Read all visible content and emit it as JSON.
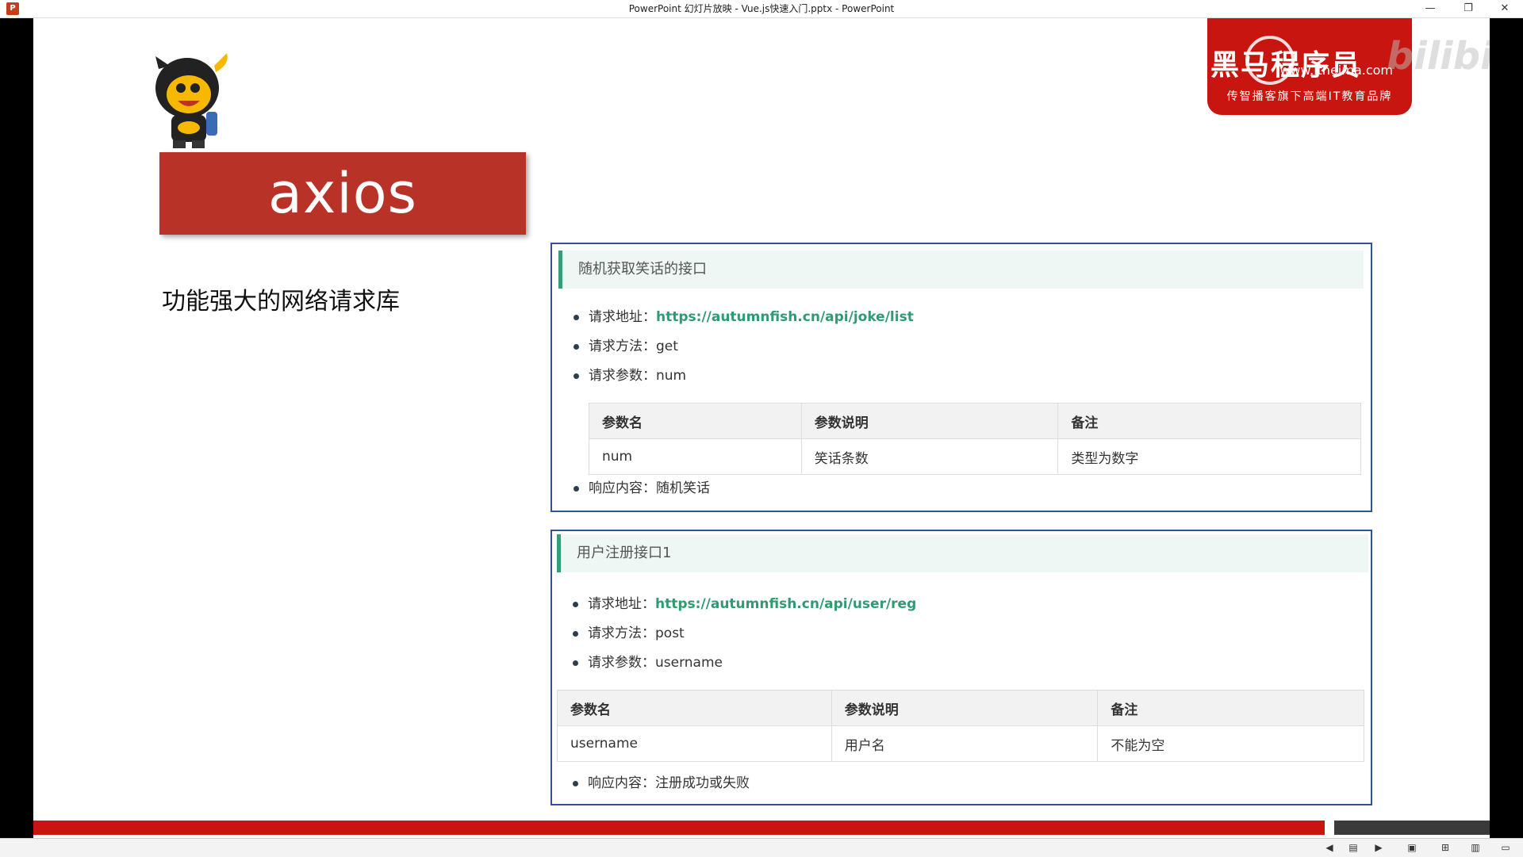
{
  "window": {
    "title": "PowerPoint 幻灯片放映  -  Vue.js快速入门.pptx - PowerPoint",
    "app_icon": "P",
    "minimize": "—",
    "restore": "❐",
    "close": "✕"
  },
  "slide": {
    "title": "axios",
    "subtitle": "功能强大的网络请求库",
    "logo": {
      "brand": "黑马程序员",
      "url": "www.itheima.com",
      "tagline": "传智播客旗下高端IT教育品牌"
    },
    "watermark": "bilibili",
    "cards": [
      {
        "header": "随机获取笑话的接口",
        "url_label": "请求地址：",
        "url": "https://autumnfish.cn/api/joke/list",
        "method_label": "请求方法：",
        "method": "get",
        "params_label": "请求参数：",
        "params": "num",
        "table_headers": [
          "参数名",
          "参数说明",
          "备注"
        ],
        "table_row": [
          "num",
          "笑话条数",
          "类型为数字"
        ],
        "response_label": "响应内容：",
        "response": "随机笑话"
      },
      {
        "header": "用户注册接口1",
        "url_label": "请求地址：",
        "url": "https://autumnfish.cn/api/user/reg",
        "method_label": "请求方法：",
        "method": "post",
        "params_label": "请求参数：",
        "params": "username",
        "table_headers": [
          "参数名",
          "参数说明",
          "备注"
        ],
        "table_row": [
          "username",
          "用户名",
          "不能为空"
        ],
        "response_label": "响应内容：",
        "response": "注册成功或失败"
      }
    ]
  },
  "colors": {
    "title_banner": "#b83228",
    "logo_red": "#c8150f",
    "card_border": "#2f5496",
    "link_green": "#2f9b72",
    "header_bg": "#eef7f3"
  },
  "statusbar_icons": [
    "prev-icon",
    "notes-icon",
    "next-icon",
    "normal-view-icon",
    "slide-sorter-icon",
    "reading-view-icon",
    "slideshow-icon"
  ]
}
